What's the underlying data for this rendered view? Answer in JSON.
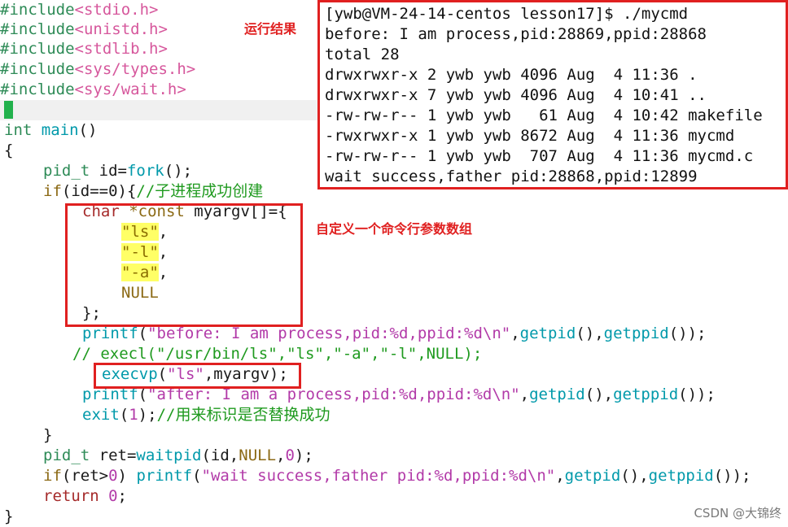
{
  "code": {
    "inc1_dir": "#include",
    "inc1_file": "<stdio.h>",
    "inc2_dir": "#include",
    "inc2_file": "<unistd.h>",
    "inc3_dir": "#include",
    "inc3_file": "<stdlib.h>",
    "inc4_dir": "#include",
    "inc4_file": "<sys/types.h>",
    "inc5_dir": "#include",
    "inc5_file": "<sys/wait.h>",
    "main_type": "int",
    "main_name": "main",
    "main_paren": "()",
    "open_brace": "{",
    "pidt_type": "pid_t",
    "pidt_rest": " id=",
    "fork_fn": "fork",
    "fork_rest": "();",
    "if_kw": "if",
    "if_cond": "(id==0){",
    "if_comment": "//子进程成功创建",
    "char_kw": "char",
    "const_part": " *const",
    "myargv_decl": " myargv[]={",
    "arg_ls": "\"ls\"",
    "arg_l": "\"-l\"",
    "arg_a": "\"-a\"",
    "comma": ",",
    "null_kw": "NULL",
    "arr_close": "};",
    "printf1_fn": "printf",
    "printf1_open": "(",
    "printf1_str": "\"before: I am process,pid:%d,ppid:%d\\n\"",
    "printf1_sep": ",",
    "getpid_fn": "getpid",
    "getpid_call": "(),",
    "getppid_fn": "getppid",
    "getppid_close": "());",
    "execl_comment": "// execl(\"/usr/bin/ls\",\"ls\",\"-a\",\"-l\",NULL);",
    "execvp_fn": "execvp",
    "execvp_open": "(",
    "execvp_str": "\"ls\"",
    "execvp_rest": ",myargv);",
    "printf2_fn": "printf",
    "printf2_open": "(",
    "printf2_str": "\"after: I am a process,pid:%d,ppid:%d\\n\"",
    "printf2_sep": ",",
    "exit_fn": "exit",
    "exit_args_open": "(",
    "exit_num": "1",
    "exit_args_close": ");",
    "exit_comment": "//用来标识是否替换成功",
    "inner_close": "}",
    "ret_type": "pid_t",
    "ret_rest": " ret=",
    "waitpid_fn": "waitpid",
    "waitpid_open": "(id,",
    "waitpid_null": "NULL",
    "waitpid_sep": ",",
    "waitpid_zero": "0",
    "waitpid_close": ");",
    "if2_kw": "if",
    "if2_cond_open": "(ret>",
    "if2_zero": "0",
    "if2_cond_close": ") ",
    "printf3_fn": "printf",
    "printf3_open": "(",
    "printf3_str": "\"wait success,father pid:%d,ppid:%d\\n\"",
    "printf3_sep": ",",
    "getpid3_fn": "getpid",
    "getpid3_call": "(),",
    "getppid3_fn": "getppid",
    "getppid3_close": "());",
    "return_kw": "return",
    "return_space": " ",
    "return_zero": "0",
    "return_semi": ";",
    "close_brace": "}"
  },
  "terminal": {
    "lines": [
      "[ywb@VM-24-14-centos lesson17]$ ./mycmd",
      "before: I am process,pid:28869,ppid:28868",
      "total 28",
      "drwxrwxr-x 2 ywb ywb 4096 Aug  4 11:36 .",
      "drwxrwxr-x 7 ywb ywb 4096 Aug  4 10:41 ..",
      "-rw-rw-r-- 1 ywb ywb   61 Aug  4 10:42 makefile",
      "-rwxrwxr-x 1 ywb ywb 8672 Aug  4 11:36 mycmd",
      "-rw-rw-r-- 1 ywb ywb  707 Aug  4 11:36 mycmd.c",
      "wait success,father pid:28868,ppid:12899"
    ]
  },
  "annotations": {
    "run_result": "运行结果",
    "custom_array": "自定义一个命令行参数数组"
  },
  "watermark": "CSDN @大锦终",
  "colors": {
    "annotation_red": "#e02020",
    "cursor_green": "#22b14c",
    "highlight_yellow": "#ffff66"
  }
}
